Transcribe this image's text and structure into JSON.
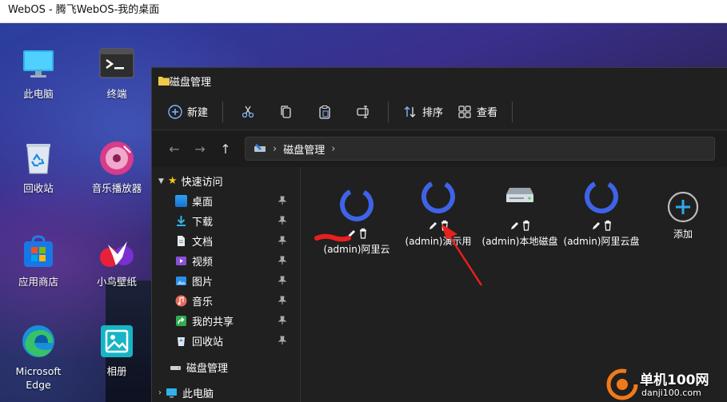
{
  "browser": {
    "title": "WebOS - 腾飞WebOS-我的桌面"
  },
  "desktop": {
    "icons": [
      {
        "label": "此电脑",
        "icon": "monitor-icon"
      },
      {
        "label": "终端",
        "icon": "terminal-icon"
      },
      {
        "label": "回收站",
        "icon": "recycle-bin-icon"
      },
      {
        "label": "音乐播放器",
        "icon": "music-player-icon"
      },
      {
        "label": "应用商店",
        "icon": "store-icon"
      },
      {
        "label": "小鸟壁纸",
        "icon": "bird-wallpaper-icon"
      },
      {
        "label": "Microsoft Edge",
        "icon": "edge-icon"
      },
      {
        "label": "相册",
        "icon": "photos-icon"
      }
    ]
  },
  "explorer": {
    "title": "磁盘管理",
    "toolbar": {
      "new_label": "新建",
      "sort_label": "排序",
      "view_label": "查看"
    },
    "address": {
      "segment": "磁盘管理"
    },
    "sidebar": {
      "quick_access": "快速访问",
      "items": [
        "桌面",
        "下载",
        "文档",
        "视频",
        "图片",
        "音乐",
        "我的共享",
        "回收站"
      ],
      "disk_mgmt": "磁盘管理",
      "this_pc": "此电脑"
    },
    "tiles": [
      {
        "name": "(admin)阿里云",
        "type": "cloud"
      },
      {
        "name": "(admin)演示用",
        "type": "cloud"
      },
      {
        "name": "(admin)本地磁盘",
        "type": "disk"
      },
      {
        "name": "(admin)阿里云盘",
        "type": "cloud"
      },
      {
        "name": "添加",
        "type": "add"
      }
    ]
  },
  "watermark": {
    "title": "单机100网",
    "url": "danji100.com"
  },
  "colors": {
    "accent": "#3f63e8",
    "window_bg": "#202020",
    "annotation_red": "#e8201e"
  }
}
